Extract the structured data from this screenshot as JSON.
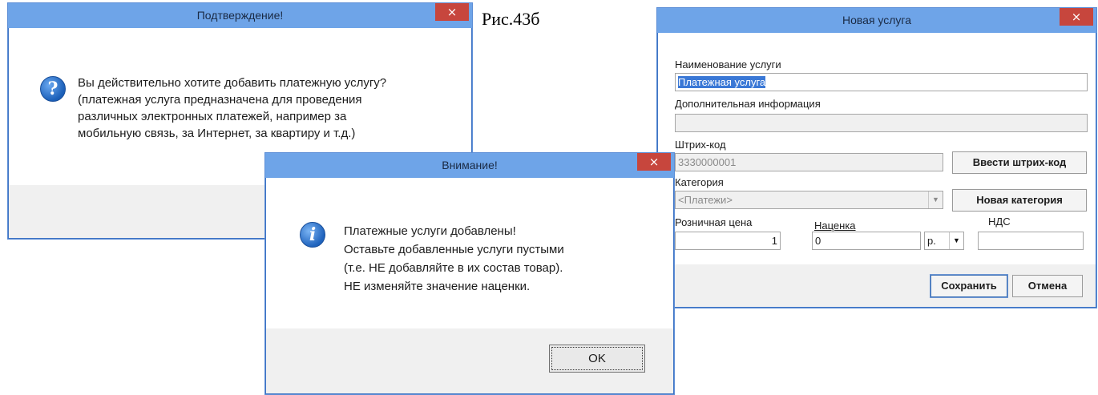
{
  "caption": "Рис.43б",
  "confirm_dialog": {
    "title": "Подтверждение!",
    "close": "×",
    "icon": "question-icon",
    "icon_glyph": "?",
    "lines": [
      "Вы действительно хотите добавить платежную услугу?",
      "(платежная услуга предназначена для проведения",
      "различных электронных платежей, например за",
      "мобильную связь, за Интернет, за квартиру и т.д.)"
    ]
  },
  "attention_dialog": {
    "title": "Внимание!",
    "close": "×",
    "icon": "info-icon",
    "icon_glyph": "i",
    "lines": [
      "Платежные услуги добавлены!",
      "Оставьте добавленные услуги пустыми",
      "(т.е. НЕ добавляйте в их состав товар).",
      "НЕ изменяйте значение наценки."
    ],
    "ok_label": "OK"
  },
  "new_service_dialog": {
    "title": "Новая услуга",
    "close": "×",
    "name_label": "Наименование услуги",
    "name_value": "Платежная услуга",
    "info_label": "Дополнительная информация",
    "info_value": "",
    "barcode_label": "Штрих-код",
    "barcode_value": "3330000001",
    "barcode_button": "Ввести штрих-код",
    "category_label": "Категория",
    "category_value": "<Платежи>",
    "category_button": "Новая категория",
    "retail_price_label": "Розничная цена",
    "retail_price_value": "1",
    "markup_label": "Наценка",
    "markup_value": "0",
    "markup_unit": "р.",
    "vat_label": "НДС",
    "vat_value": "",
    "save_label": "Сохранить",
    "cancel_label": "Отмена"
  }
}
